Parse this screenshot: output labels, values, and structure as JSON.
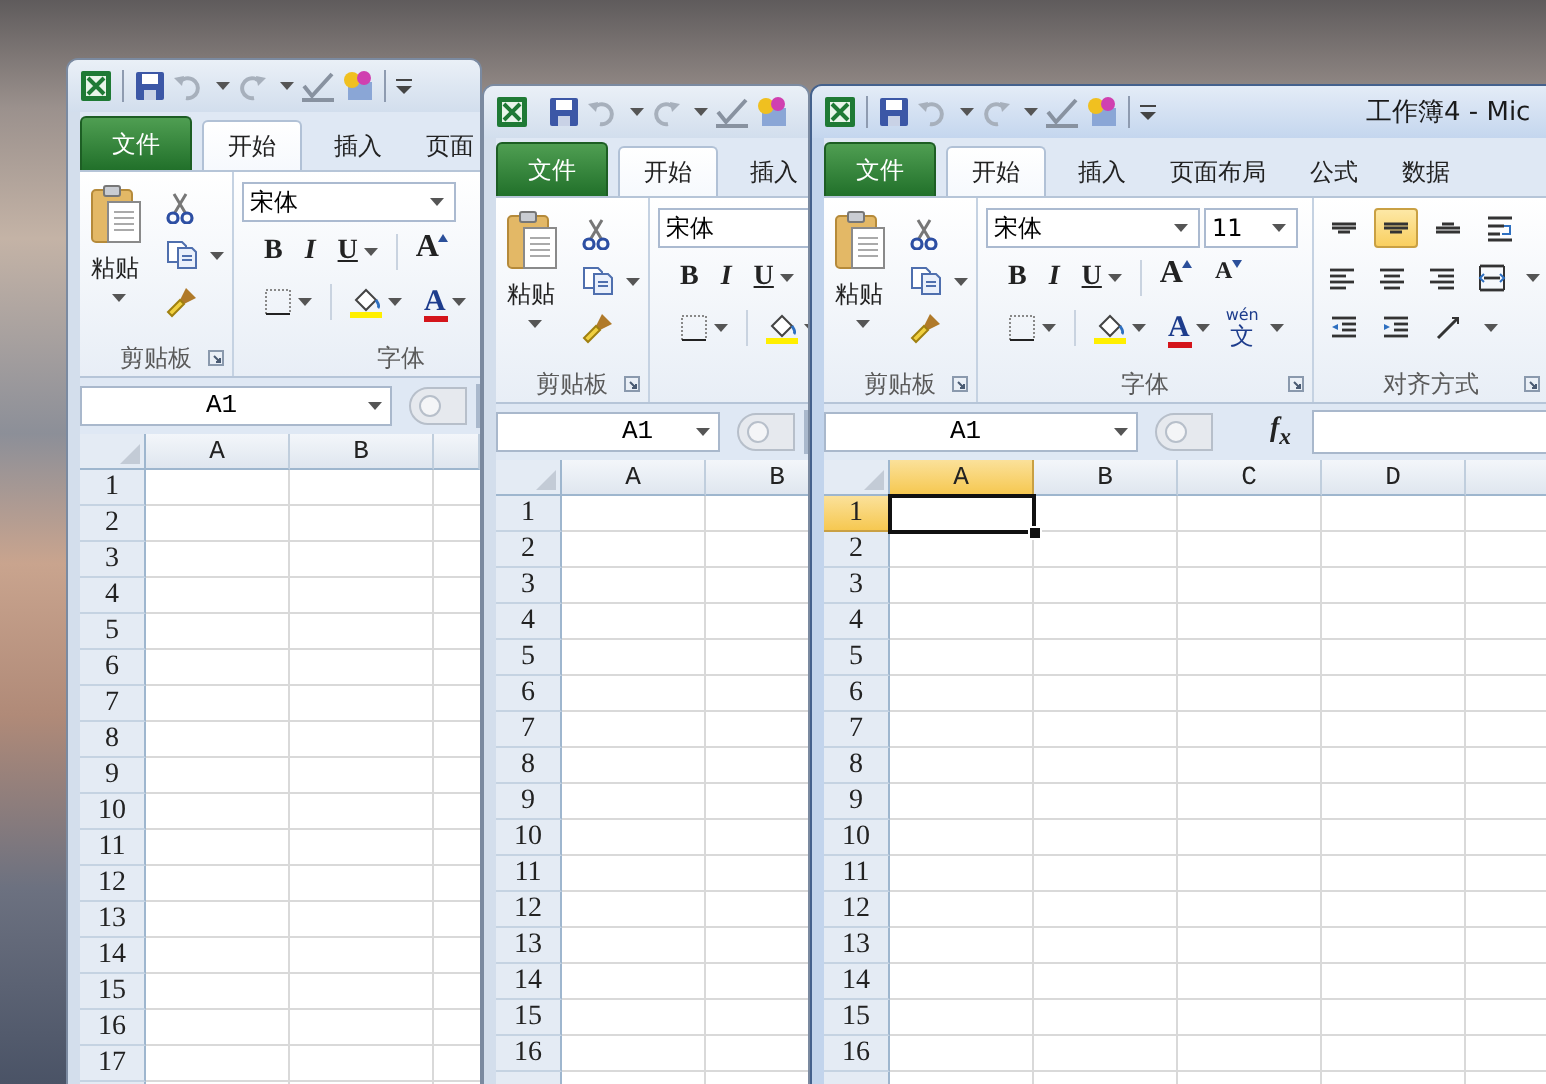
{
  "windows": [
    {
      "active": false,
      "tabs": [
        {
          "kind": "file",
          "label": "文件",
          "selected": false
        },
        {
          "kind": "tab",
          "label": "开始",
          "selected": true
        },
        {
          "kind": "tab",
          "label": "插入",
          "selected": false
        },
        {
          "kind": "tab",
          "label": "页面",
          "selected": false
        }
      ],
      "groups": [
        {
          "kind": "clipboard",
          "label": "剪贴板",
          "paste_label": "粘贴"
        },
        {
          "kind": "font",
          "label": "字体",
          "font_name": "宋体",
          "top_buttons": [
            {
              "kind": "bold",
              "label": "B"
            },
            {
              "kind": "italic",
              "label": "I"
            },
            {
              "kind": "underline",
              "label": "U"
            },
            {
              "kind": "grow",
              "label": "A"
            }
          ],
          "bottom_buttons": [
            {
              "kind": "borders"
            },
            {
              "kind": "fill"
            },
            {
              "kind": "color",
              "label": "A"
            }
          ]
        }
      ],
      "name_box": "A1",
      "columns": [
        {
          "label": "A",
          "selected": false
        },
        {
          "label": "B",
          "selected": false
        }
      ],
      "rows": [
        {
          "label": "1",
          "selected": false
        },
        {
          "label": "2",
          "selected": false
        },
        {
          "label": "3",
          "selected": false
        },
        {
          "label": "4",
          "selected": false
        },
        {
          "label": "5",
          "selected": false
        },
        {
          "label": "6",
          "selected": false
        },
        {
          "label": "7",
          "selected": false
        },
        {
          "label": "8",
          "selected": false
        },
        {
          "label": "9",
          "selected": false
        },
        {
          "label": "10",
          "selected": false
        },
        {
          "label": "11",
          "selected": false
        },
        {
          "label": "12",
          "selected": false
        },
        {
          "label": "13",
          "selected": false
        },
        {
          "label": "14",
          "selected": false
        },
        {
          "label": "15",
          "selected": false
        },
        {
          "label": "16",
          "selected": false
        },
        {
          "label": "17",
          "selected": false
        }
      ]
    },
    {
      "active": false,
      "tabs": [
        {
          "kind": "file",
          "label": "文件",
          "selected": false
        },
        {
          "kind": "tab",
          "label": "开始",
          "selected": true
        },
        {
          "kind": "tab",
          "label": "插入",
          "selected": false
        }
      ],
      "groups": [
        {
          "kind": "clipboard",
          "label": "剪贴板",
          "paste_label": "粘贴"
        },
        {
          "kind": "font",
          "font_name": "宋体",
          "top_buttons": [
            {
              "kind": "bold",
              "label": "B"
            },
            {
              "kind": "italic",
              "label": "I"
            },
            {
              "kind": "underline",
              "label": "U"
            }
          ],
          "bottom_buttons": [
            {
              "kind": "borders"
            },
            {
              "kind": "fill"
            }
          ]
        }
      ],
      "name_box": "A1",
      "columns": [
        {
          "label": "A",
          "selected": false
        },
        {
          "label": "B",
          "selected": false
        }
      ],
      "rows": [
        {
          "label": "1",
          "selected": false
        },
        {
          "label": "2",
          "selected": false
        },
        {
          "label": "3",
          "selected": false
        },
        {
          "label": "4",
          "selected": false
        },
        {
          "label": "5",
          "selected": false
        },
        {
          "label": "6",
          "selected": false
        },
        {
          "label": "7",
          "selected": false
        },
        {
          "label": "8",
          "selected": false
        },
        {
          "label": "9",
          "selected": false
        },
        {
          "label": "10",
          "selected": false
        },
        {
          "label": "11",
          "selected": false
        },
        {
          "label": "12",
          "selected": false
        },
        {
          "label": "13",
          "selected": false
        },
        {
          "label": "14",
          "selected": false
        },
        {
          "label": "15",
          "selected": false
        },
        {
          "label": "16",
          "selected": false
        }
      ]
    },
    {
      "active": true,
      "title": "工作簿4 - Mic",
      "tabs": [
        {
          "kind": "file",
          "label": "文件",
          "selected": false
        },
        {
          "kind": "tab",
          "label": "开始",
          "selected": true
        },
        {
          "kind": "tab",
          "label": "插入",
          "selected": false
        },
        {
          "kind": "tab",
          "label": "页面布局",
          "selected": false
        },
        {
          "kind": "tab",
          "label": "公式",
          "selected": false
        },
        {
          "kind": "tab",
          "label": "数据",
          "selected": false
        }
      ],
      "groups": [
        {
          "kind": "clipboard",
          "label": "剪贴板",
          "paste_label": "粘贴"
        },
        {
          "kind": "font",
          "label": "字体",
          "font_name": "宋体",
          "font_size": "11",
          "top_buttons": [
            {
              "kind": "bold",
              "label": "B"
            },
            {
              "kind": "italic",
              "label": "I"
            },
            {
              "kind": "underline",
              "label": "U"
            },
            {
              "kind": "grow",
              "label": "A"
            },
            {
              "kind": "shrink",
              "label": "A"
            }
          ],
          "bottom_buttons": [
            {
              "kind": "borders"
            },
            {
              "kind": "fill"
            },
            {
              "kind": "color",
              "label": "A"
            },
            {
              "kind": "phonetic",
              "label": "文",
              "ruby": "wén"
            }
          ]
        },
        {
          "kind": "align",
          "label": "对齐方式",
          "button_rows": [
            [
              {
                "kind": "top",
                "selected": false
              },
              {
                "kind": "middle",
                "selected": true
              },
              {
                "kind": "bottom",
                "selected": false
              },
              {
                "kind": "wrap",
                "selected": false
              }
            ],
            [
              {
                "kind": "left",
                "selected": false
              },
              {
                "kind": "center",
                "selected": false
              },
              {
                "kind": "right",
                "selected": false
              },
              {
                "kind": "merge",
                "selected": false
              }
            ],
            [
              {
                "kind": "outdent",
                "selected": false
              },
              {
                "kind": "indent",
                "selected": false
              },
              {
                "kind": "orient",
                "selected": false
              }
            ]
          ]
        }
      ],
      "name_box": "A1",
      "function_label": "f$_{x}$",
      "columns": [
        {
          "label": "A",
          "selected": true
        },
        {
          "label": "B",
          "selected": false
        },
        {
          "label": "C",
          "selected": false
        },
        {
          "label": "D",
          "selected": false
        }
      ],
      "rows": [
        {
          "label": "1",
          "selected": true
        },
        {
          "label": "2",
          "selected": false
        },
        {
          "label": "3",
          "selected": false
        },
        {
          "label": "4",
          "selected": false
        },
        {
          "label": "5",
          "selected": false
        },
        {
          "label": "6",
          "selected": false
        },
        {
          "label": "7",
          "selected": false
        },
        {
          "label": "8",
          "selected": false
        },
        {
          "label": "9",
          "selected": false
        },
        {
          "label": "10",
          "selected": false
        },
        {
          "label": "11",
          "selected": false
        },
        {
          "label": "12",
          "selected": false
        },
        {
          "label": "13",
          "selected": false
        },
        {
          "label": "14",
          "selected": false
        },
        {
          "label": "15",
          "selected": false
        },
        {
          "label": "16",
          "selected": false
        }
      ]
    }
  ]
}
